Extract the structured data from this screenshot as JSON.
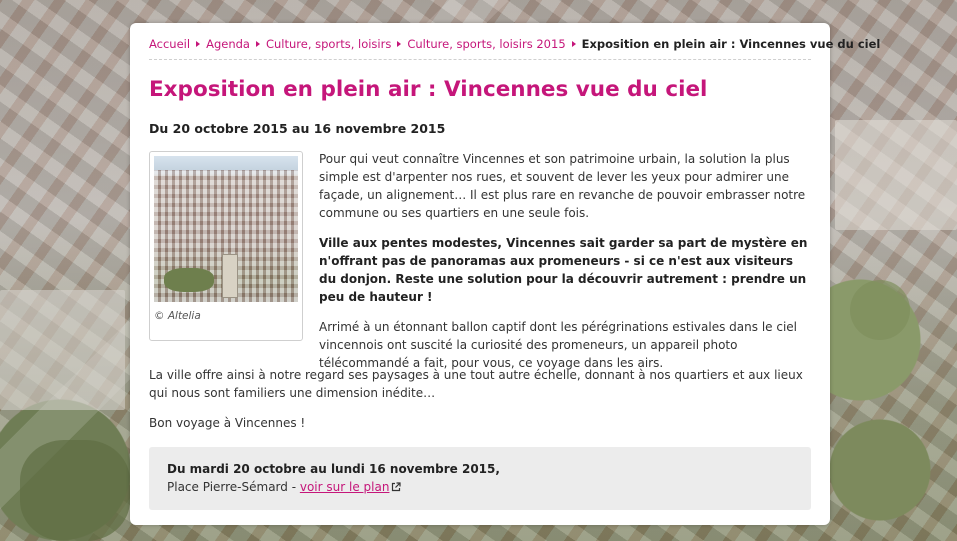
{
  "breadcrumb": {
    "items": [
      "Accueil",
      "Agenda",
      "Culture, sports, loisirs",
      "Culture, sports, loisirs 2015"
    ],
    "current": "Exposition en plein air : Vincennes vue du ciel"
  },
  "title": "Exposition en plein air : Vincennes vue du ciel",
  "date_range": "Du 20 octobre 2015 au 16 novembre 2015",
  "figure": {
    "caption": "© Altelia"
  },
  "paragraphs": [
    "Pour qui veut connaître Vincennes et son patrimoine urbain, la solution la plus simple est d'arpenter nos rues, et souvent de lever les yeux pour admirer une façade, un alignement… Il est plus rare en revanche de pouvoir embrasser notre commune ou ses quartiers en une seule fois.",
    "Ville aux pentes modestes, Vincennes sait garder sa part de mystère en n'offrant pas de panoramas aux promeneurs - si ce n'est aux visiteurs du donjon. Reste une solution pour la découvrir autrement : prendre un peu de hauteur !",
    "Arrimé à un étonnant ballon captif dont les pérégrinations estivales dans le ciel vincennois ont suscité la curiosité des promeneurs, un appareil photo télécommandé a fait, pour vous, ce voyage dans les airs.",
    "La ville offre ainsi à notre regard ses paysages à une tout autre échelle, donnant à nos quartiers et aux lieux qui nous sont familiers une dimension inédite…",
    "Bon voyage à Vincennes !"
  ],
  "info": {
    "dates": "Du mardi 20 octobre au lundi 16 novembre 2015,",
    "place": "Place Pierre-Sémard - ",
    "map_link": "voir sur le plan"
  },
  "colors": {
    "accent": "#c5167a"
  }
}
